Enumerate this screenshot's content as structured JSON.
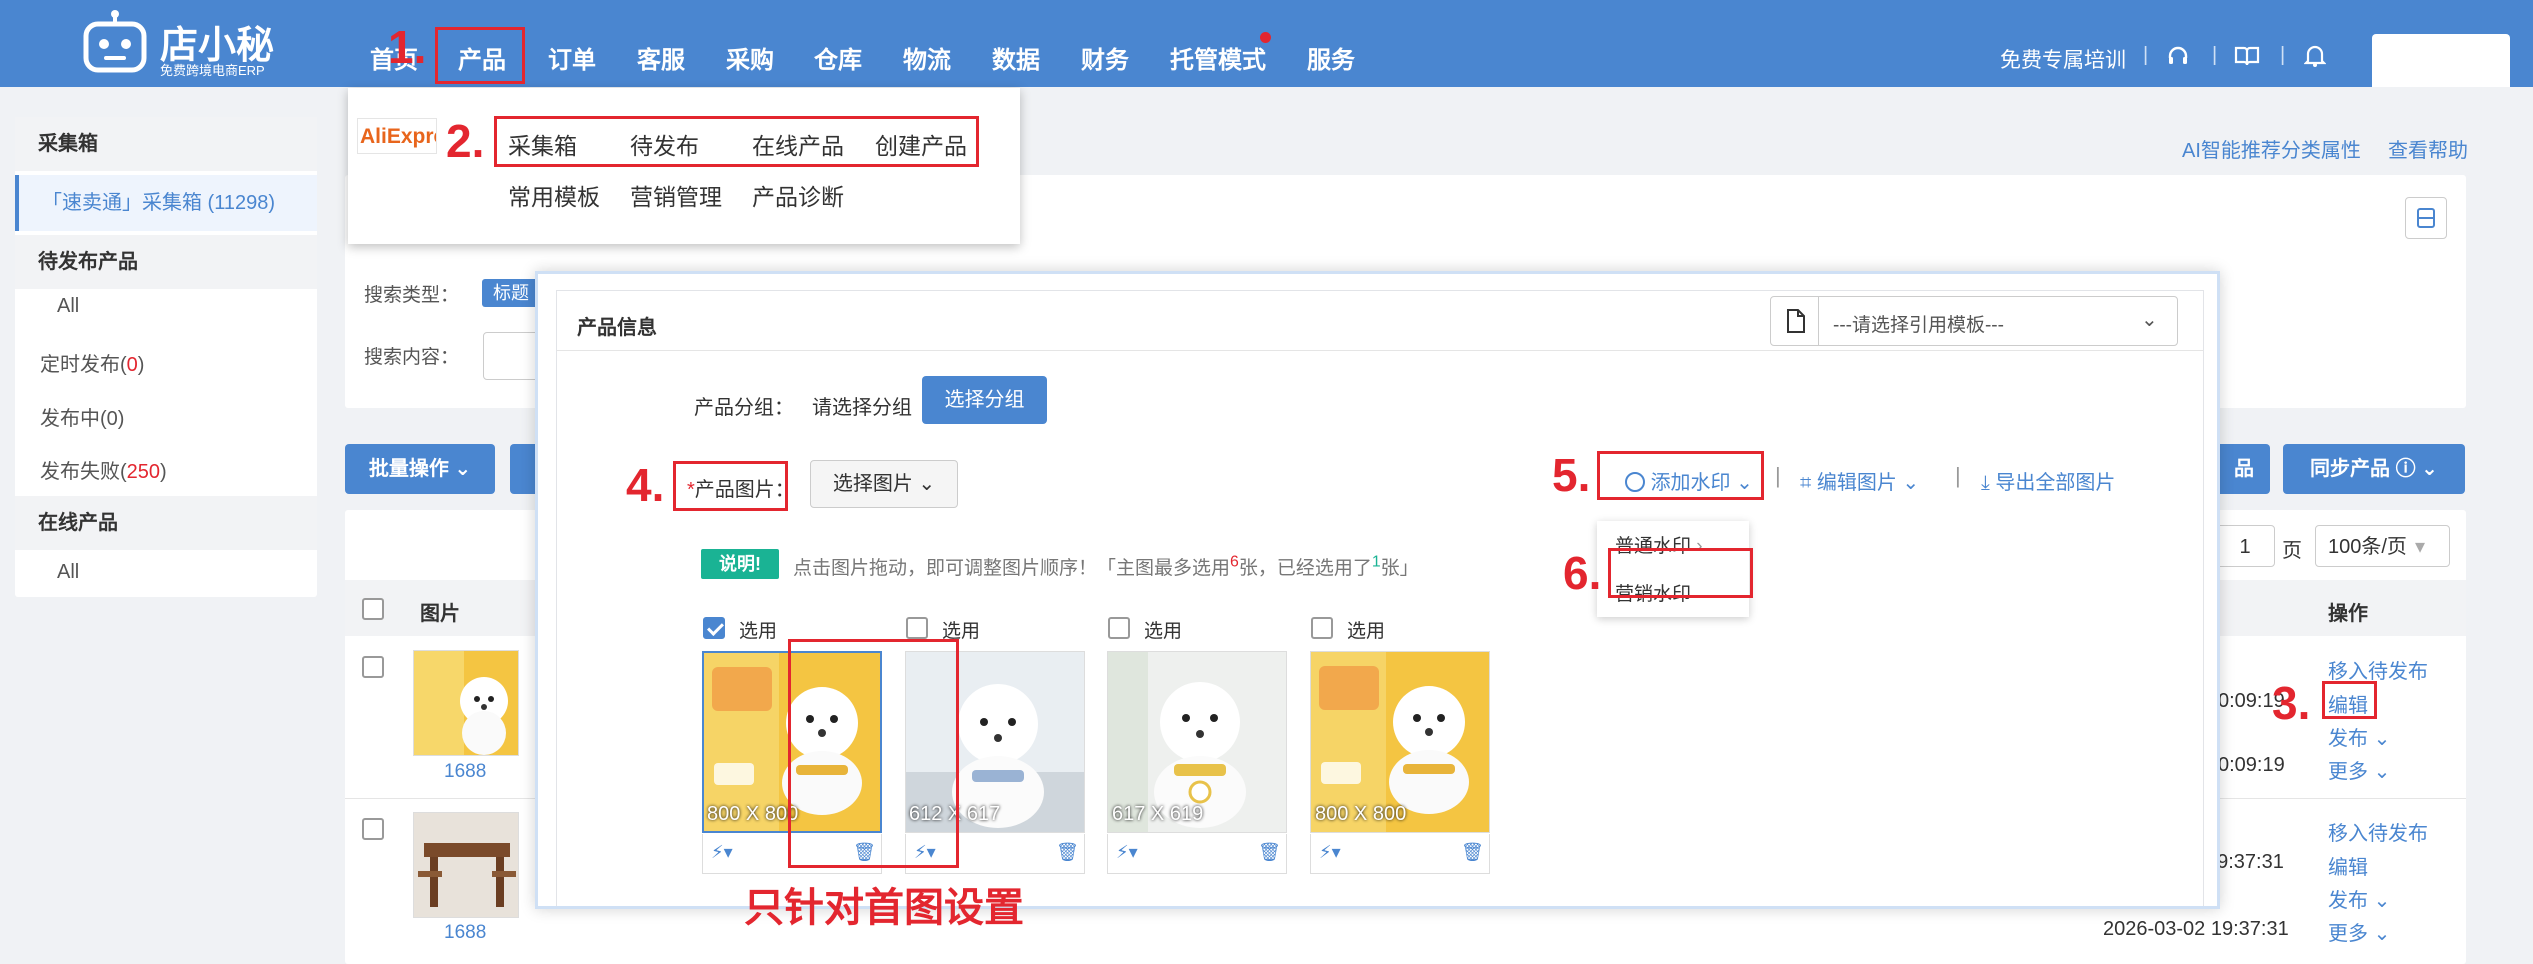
{
  "header": {
    "logo_title": "店小秘",
    "logo_subtitle": "免费跨境电商ERP",
    "nav": [
      "首页",
      "产品",
      "订单",
      "客服",
      "采购",
      "仓库",
      "物流",
      "数据",
      "财务",
      "托管模式",
      "服务"
    ],
    "training_link": "免费专属培训",
    "separator": "|"
  },
  "product_menu": {
    "platform": "AliExpress",
    "row1": [
      "采集箱",
      "待发布",
      "在线产品",
      "创建产品"
    ],
    "row2": [
      "常用模板",
      "营销管理",
      "产品诊断"
    ]
  },
  "sidebar": {
    "section1_title": "采集箱",
    "section1_item": "「速卖通」采集箱 (11298)",
    "section2_title": "待发布产品",
    "all_label": "All",
    "scheduled_label": "定时发布(",
    "scheduled_count": "0",
    "publishing_label": "发布中(0)",
    "failed_label": "发布失败(",
    "failed_count": "250",
    "close_paren": ")",
    "section3_title": "在线产品",
    "section3_all": "All"
  },
  "main": {
    "ai_link": "AI智能推荐分类属性",
    "help_link": "查看帮助",
    "search_type_label": "搜索类型：",
    "search_type_tag": "标题",
    "search_content_label": "搜索内容：",
    "batch_btn": "批量操作",
    "right_btn_partial": "品",
    "sync_btn": "同步产品",
    "page_num": "1",
    "page_unit": "页",
    "page_size": "100条/页",
    "col_image": "图片",
    "col_action": "操作",
    "rows": [
      {
        "source": "1688",
        "time1": "0:09:19",
        "time2": "0:09:19",
        "actions": [
          "移入待发布",
          "编辑",
          "发布",
          "更多"
        ]
      },
      {
        "source": "1688",
        "time1": "19:37:31",
        "time2": "2026-03-02 19:37:31",
        "actions": [
          "移入待发布",
          "编辑",
          "发布",
          "更多"
        ]
      }
    ]
  },
  "modal": {
    "section_title": "产品信息",
    "template_placeholder": "---请选择引用模板---",
    "group_label": "产品分组：",
    "group_value": "请选择分组",
    "group_btn": "选择分组",
    "image_label": "产品图片：",
    "required_mark": "*",
    "select_image_btn": "选择图片",
    "watermark_btn": "添加水印",
    "edit_image_btn": "编辑图片",
    "export_btn": "导出全部图片",
    "watermark_options": [
      "普通水印",
      "营销水印"
    ],
    "note_tag": "说明!",
    "note_text_1": "点击图片拖动，即可调整图片顺序！「主图最多选用",
    "note_max": "6",
    "note_text_2": "张，已经选用了",
    "note_used": "1",
    "note_text_3": "张」",
    "select_label": "选用",
    "images": [
      {
        "size": "800 X 800",
        "selected": true,
        "style": "yellow"
      },
      {
        "size": "612 X 617",
        "selected": false,
        "style": "white"
      },
      {
        "size": "617 X 619",
        "selected": false,
        "style": "light"
      },
      {
        "size": "800 X 800",
        "selected": false,
        "style": "yellow"
      }
    ]
  },
  "annotations": {
    "step1": "1.",
    "step2": "2.",
    "step3": "3.",
    "step4": "4.",
    "step5": "5.",
    "step6": "6.",
    "note": "只针对首图设置"
  },
  "colors": {
    "header_blue": "#4a86d0",
    "annotation_red": "#e3262f",
    "note_tag_teal": "#1ab394"
  }
}
